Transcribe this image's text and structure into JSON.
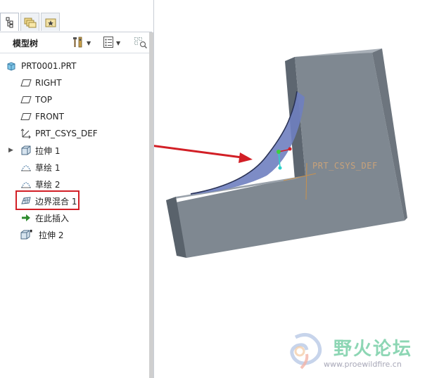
{
  "tabs": [
    {
      "name": "model-tree-tab",
      "icon": "tree-icon"
    },
    {
      "name": "folder-browser-tab",
      "icon": "folders-icon"
    },
    {
      "name": "favorites-tab",
      "icon": "favorites-star-icon"
    }
  ],
  "toolbar": {
    "title": "模型树",
    "settings_icon": "tools-icon",
    "show_icon": "list-icon",
    "filter_icon": "filter-icon"
  },
  "tree": {
    "items": [
      {
        "label": "PRT0001.PRT",
        "icon": "part-icon"
      },
      {
        "label": "RIGHT",
        "icon": "datum-plane-icon"
      },
      {
        "label": "TOP",
        "icon": "datum-plane-icon"
      },
      {
        "label": "FRONT",
        "icon": "datum-plane-icon"
      },
      {
        "label": "PRT_CSYS_DEF",
        "icon": "csys-icon"
      },
      {
        "label": "拉伸 1",
        "icon": "extrude-icon"
      },
      {
        "label": "草绘 1",
        "icon": "sketch-icon"
      },
      {
        "label": "草绘 2",
        "icon": "sketch-icon"
      },
      {
        "label": "边界混合 1",
        "icon": "boundary-blend-icon"
      },
      {
        "label": "在此插入",
        "icon": "insert-here-arrow-icon"
      },
      {
        "label": "拉伸 2",
        "icon": "extrude-icon"
      }
    ]
  },
  "viewport": {
    "csys_label": "PRT_CSYS_DEF",
    "annotation_arrow_color": "#d21f26",
    "model_color": "#7f8891",
    "surface_color": "#6f7fc0"
  },
  "watermark": {
    "title": "野火论坛",
    "url": "www.proewildfire.cn"
  },
  "colors": {
    "highlight": "#d21f26",
    "panel_border": "#c9ced6"
  }
}
